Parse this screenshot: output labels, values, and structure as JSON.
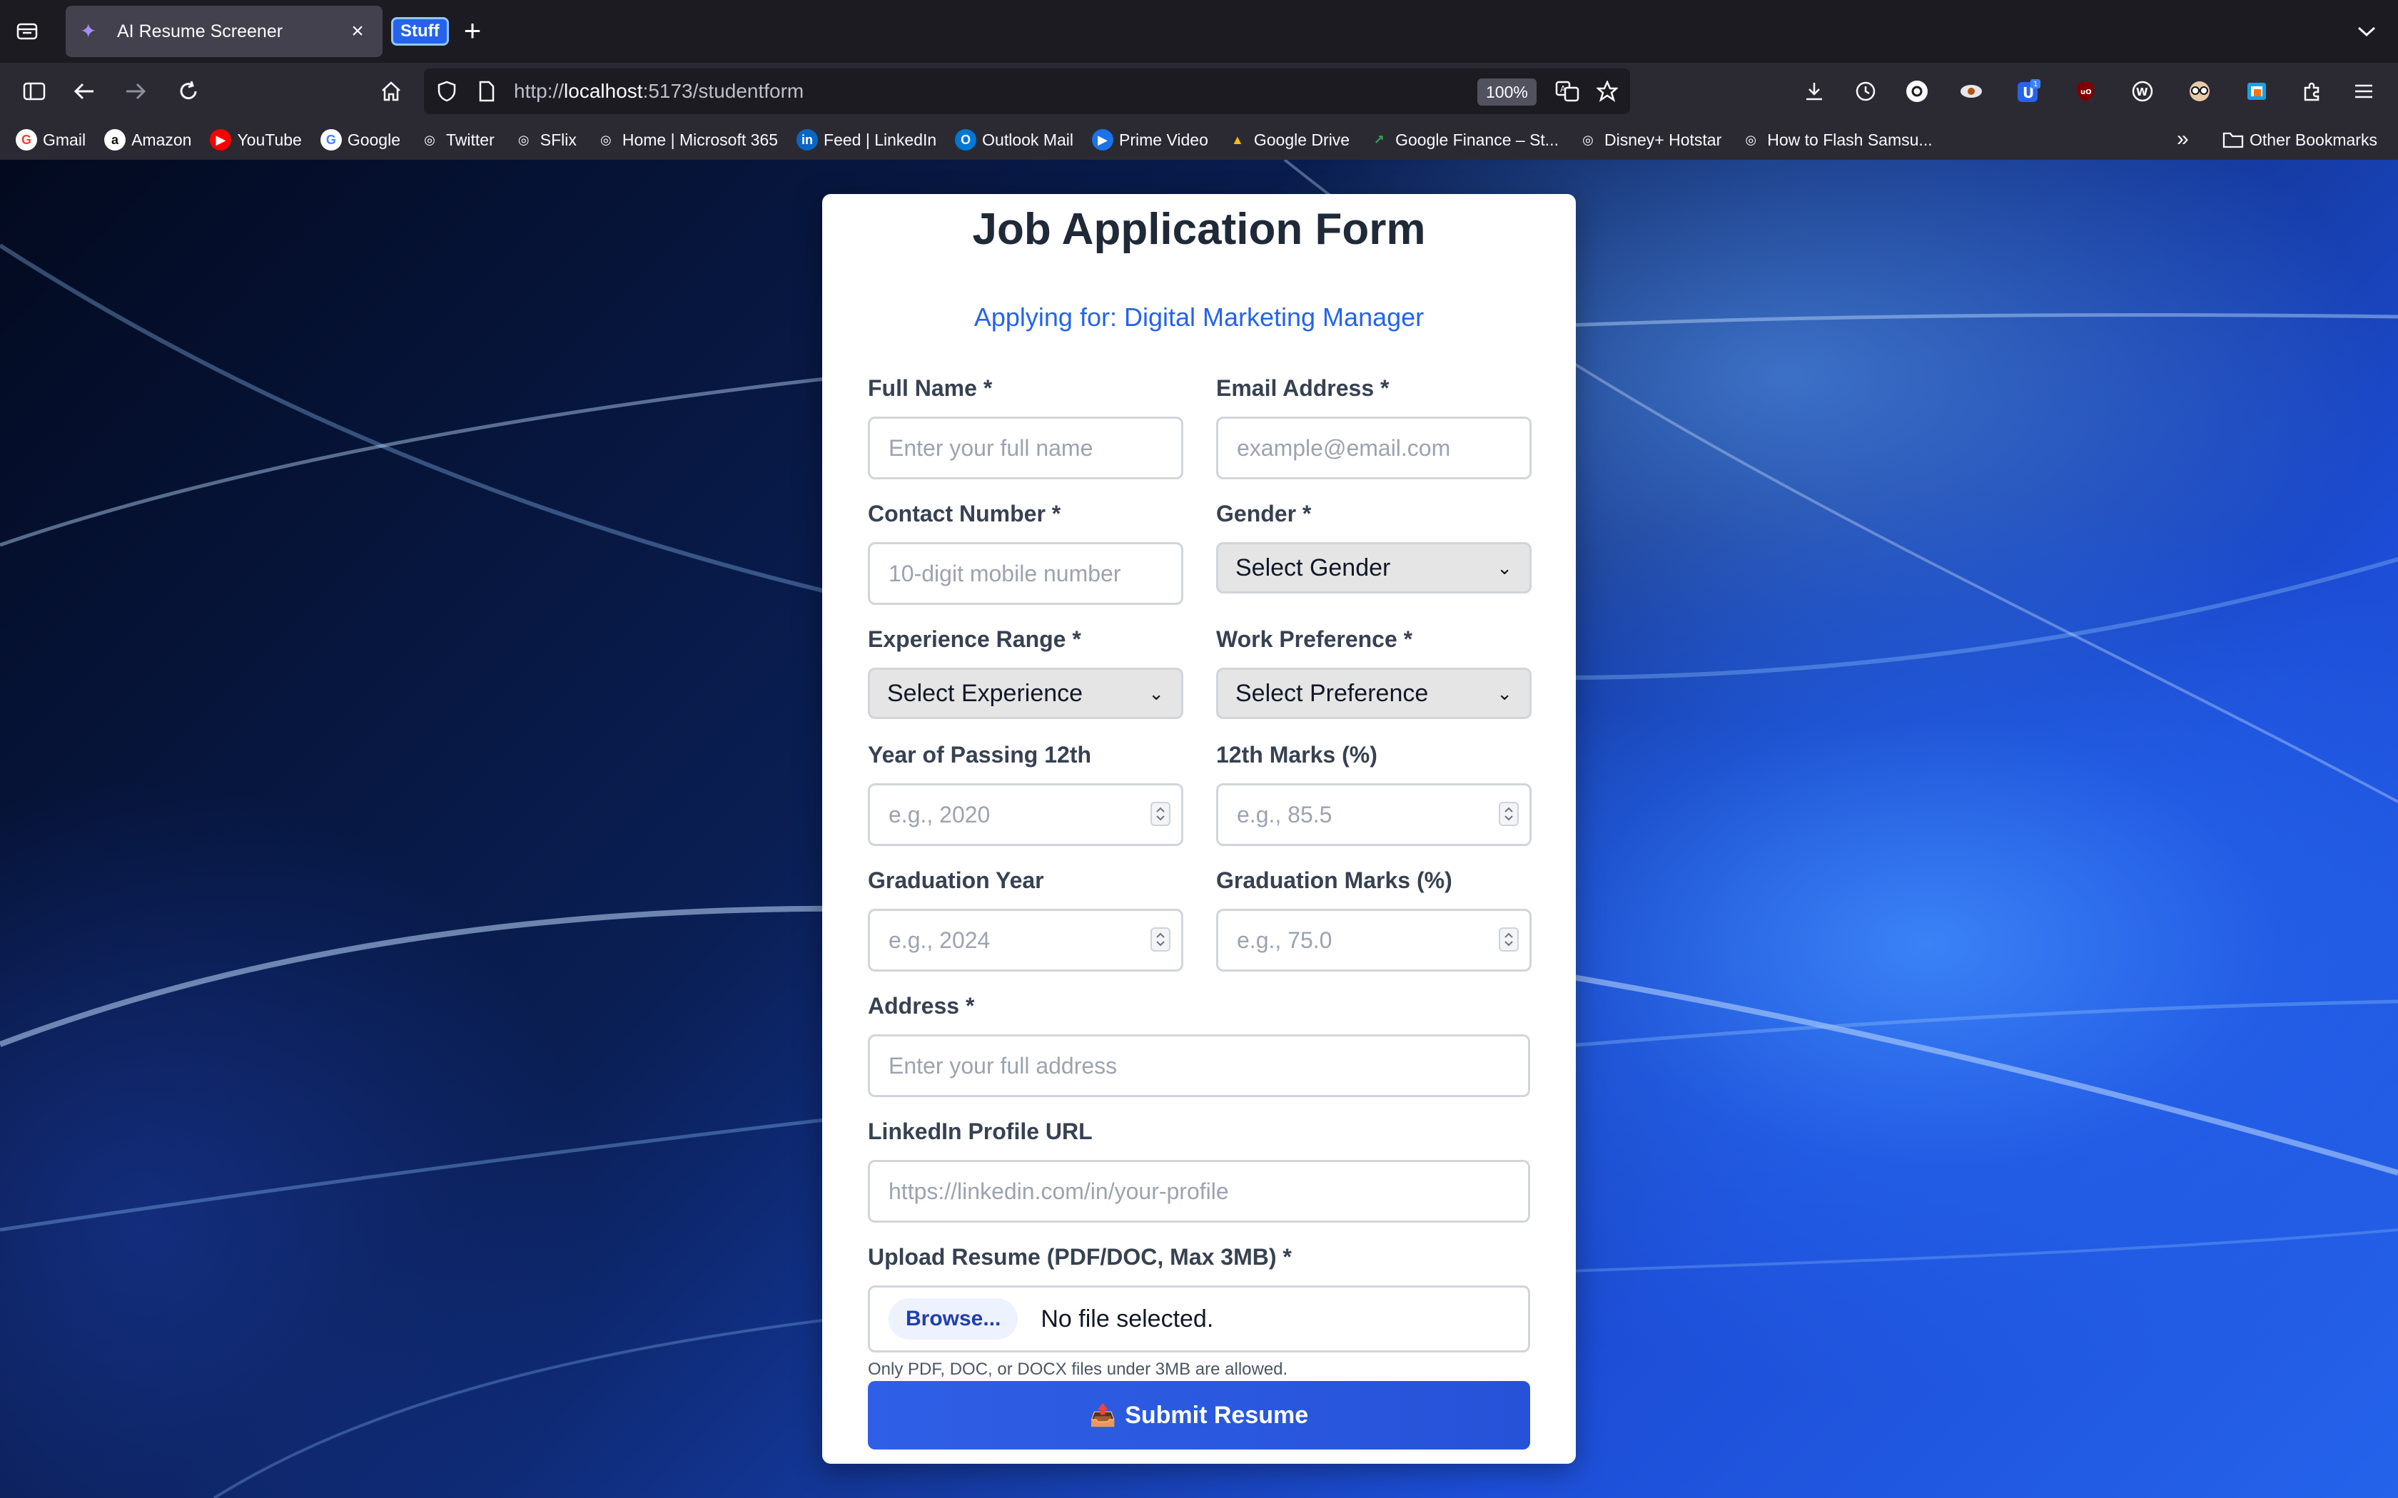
{
  "browser": {
    "tab": {
      "title": "AI Resume Screener",
      "close": "×"
    },
    "tab_group": "Stuff",
    "new_tab": "+",
    "url": {
      "scheme": "http://",
      "host": "localhost",
      "rest": ":5173/studentform"
    },
    "zoom": "100%",
    "bookmarks": [
      {
        "label": "Gmail",
        "icon": "G",
        "color": "#ea4335",
        "bg": "#ffffff"
      },
      {
        "label": "Amazon",
        "icon": "a",
        "color": "#111111",
        "bg": "#ffffff"
      },
      {
        "label": "YouTube",
        "icon": "▶",
        "color": "#ffffff",
        "bg": "#ff0000"
      },
      {
        "label": "Google",
        "icon": "G",
        "color": "#4285f4",
        "bg": "#ffffff"
      },
      {
        "label": "Twitter",
        "icon": "◎",
        "color": "#fbfbfe",
        "bg": "transparent"
      },
      {
        "label": "SFlix",
        "icon": "◎",
        "color": "#fbfbfe",
        "bg": "transparent"
      },
      {
        "label": "Home | Microsoft 365",
        "icon": "◎",
        "color": "#fbfbfe",
        "bg": "transparent"
      },
      {
        "label": "Feed | LinkedIn",
        "icon": "in",
        "color": "#ffffff",
        "bg": "#0a66c2"
      },
      {
        "label": "Outlook Mail",
        "icon": "O",
        "color": "#ffffff",
        "bg": "#0078d4"
      },
      {
        "label": "Prime Video",
        "icon": "▶",
        "color": "#ffffff",
        "bg": "#1a73e8"
      },
      {
        "label": "Google Drive",
        "icon": "▲",
        "color": "#fbbc04",
        "bg": "transparent"
      },
      {
        "label": "Google Finance – St...",
        "icon": "↗",
        "color": "#34a853",
        "bg": "transparent"
      },
      {
        "label": "Disney+ Hotstar",
        "icon": "◎",
        "color": "#fbfbfe",
        "bg": "transparent"
      },
      {
        "label": "How to Flash Samsu...",
        "icon": "◎",
        "color": "#fbfbfe",
        "bg": "transparent"
      }
    ],
    "other_bookmarks": "Other Bookmarks"
  },
  "form": {
    "title": "Job Application Form",
    "subtitle": "Applying for: Digital Marketing Manager",
    "full_name": {
      "label": "Full Name *",
      "placeholder": "Enter your full name"
    },
    "email": {
      "label": "Email Address *",
      "placeholder": "example@email.com"
    },
    "contact": {
      "label": "Contact Number *",
      "placeholder": "10-digit mobile number"
    },
    "gender": {
      "label": "Gender *",
      "value": "Select Gender"
    },
    "experience": {
      "label": "Experience Range *",
      "value": "Select Experience"
    },
    "work_pref": {
      "label": "Work Preference *",
      "value": "Select Preference"
    },
    "year12": {
      "label": "Year of Passing 12th",
      "placeholder": "e.g., 2020"
    },
    "marks12": {
      "label": "12th Marks (%)",
      "placeholder": "e.g., 85.5"
    },
    "grad_year": {
      "label": "Graduation Year",
      "placeholder": "e.g., 2024"
    },
    "grad_marks": {
      "label": "Graduation Marks (%)",
      "placeholder": "e.g., 75.0"
    },
    "address": {
      "label": "Address *",
      "placeholder": "Enter your full address"
    },
    "linkedin": {
      "label": "LinkedIn Profile URL",
      "placeholder": "https://linkedin.com/in/your-profile"
    },
    "resume": {
      "label": "Upload Resume (PDF/DOC, Max 3MB) *",
      "browse": "Browse...",
      "status": "No file selected.",
      "hint": "Only PDF, DOC, or DOCX files under 3MB are allowed."
    },
    "submit": {
      "icon": "📤",
      "label": "Submit Resume"
    }
  },
  "colors": {
    "accent": "#2563eb",
    "submit": "#2b59e0",
    "card": "#ffffff"
  }
}
